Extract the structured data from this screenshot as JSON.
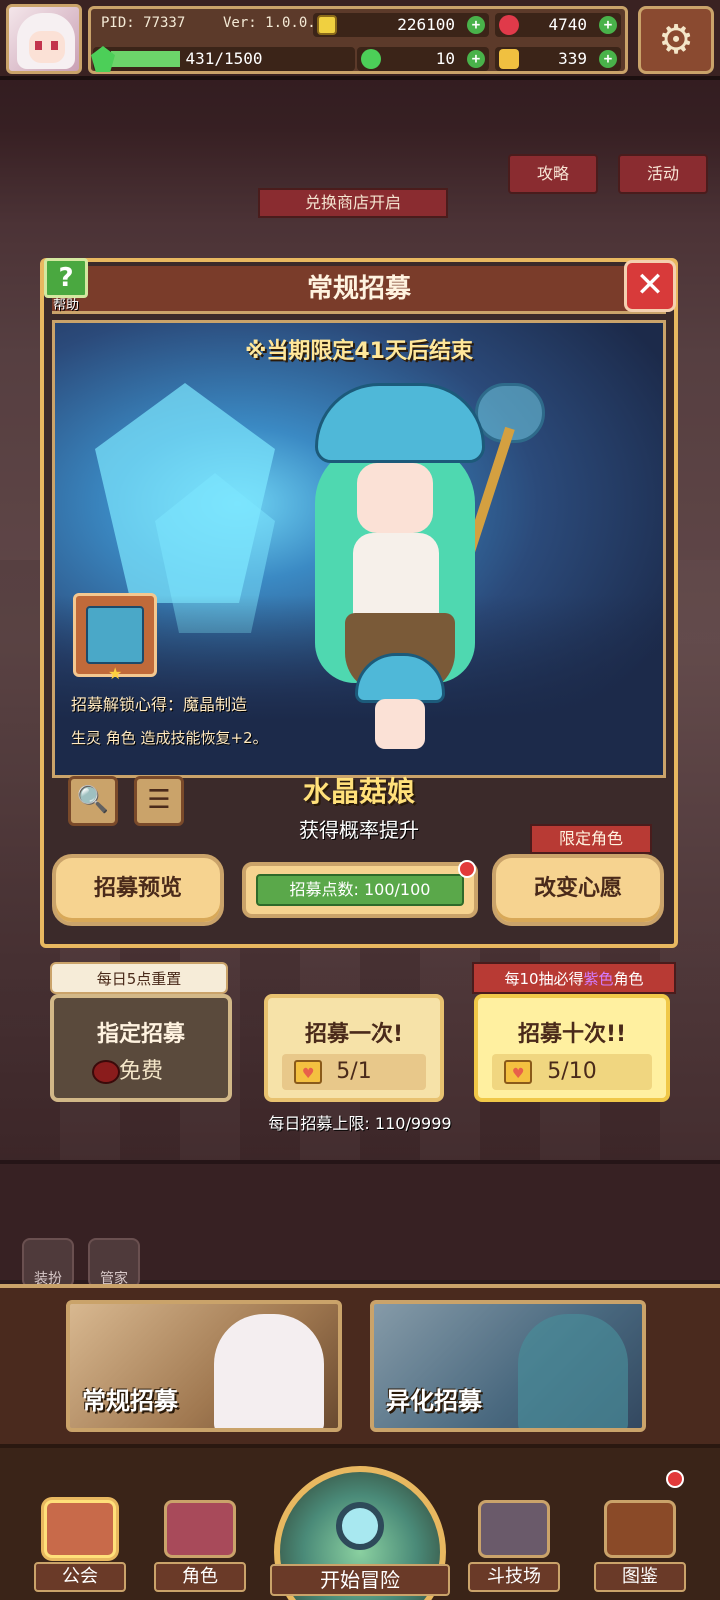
{
  "hud": {
    "pid": "PID: 77337",
    "version": "Ver: 1.0.0.0",
    "gold": "226100",
    "gems": "4740",
    "clover": "10",
    "keys": "339",
    "xp": "431/1500",
    "xp_fraction": 0.2873
  },
  "background": {
    "guide_label": "攻略",
    "event_label": "活动",
    "shop_banner": "兑换商店开启"
  },
  "modal": {
    "title": "常规招募",
    "help_label": "帮助",
    "close_symbol": "✕",
    "limited_notice": "※当期限定41天后结束",
    "skill_unlock_prefix": "招募解锁心得：",
    "skill_unlock_name": "魔晶制造",
    "skill_desc": "生灵 角色 造成技能恢复+2。",
    "character_name": "水晶菇娘",
    "rate_up": "获得概率提升",
    "search_icon_glyph": "🔍",
    "list_icon_glyph": "☰",
    "preview_button": "招募预览",
    "points_label": "招募点数: 100/100",
    "limited_role_tag": "限定角色",
    "change_wish_button": "改变心愿"
  },
  "recruit": {
    "daily_reset_tag": "每日5点重置",
    "guarantee_prefix": "每10抽必得",
    "guarantee_color_word": "紫色",
    "guarantee_suffix": "角色",
    "designate_title": "指定招募",
    "designate_cost": "免费",
    "once_title": "招募一次!",
    "once_cost": "5/1",
    "ten_title": "招募十次!!",
    "ten_cost": "5/10",
    "daily_limit": "每日招募上限: 110/9999"
  },
  "side": {
    "dress_label": "装扮",
    "butler_label": "管家"
  },
  "pools": {
    "regular": "常规招募",
    "alien": "异化招募"
  },
  "nav": {
    "guild": "公会",
    "character": "角色",
    "start": "开始冒险",
    "arena": "斗技场",
    "codex": "图鉴"
  },
  "colors": {
    "accent_gold": "#caa36a",
    "title_bar": "#7a3c2a",
    "highlight_name": "#ffe07a",
    "plus_green": "#49b24a",
    "alert_red": "#e23a3a",
    "purple_word": "#d37cff"
  }
}
